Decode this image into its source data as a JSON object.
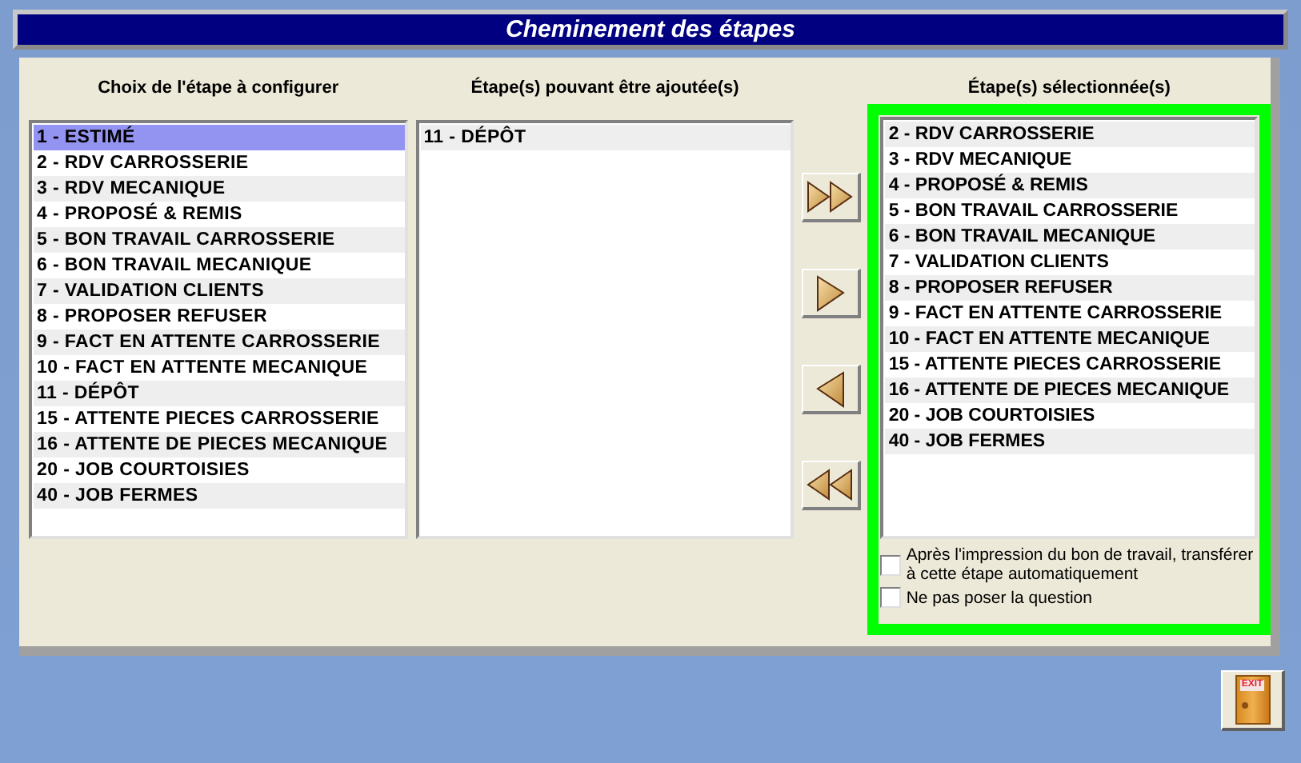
{
  "window": {
    "title": "Cheminement des étapes"
  },
  "lists": [
    {
      "heading": "Choix de l'étape à configurer",
      "items": [
        {
          "label": "1 - ESTIMÉ",
          "selected": true
        },
        {
          "label": "2 - RDV CARROSSERIE",
          "selected": false
        },
        {
          "label": "3 - RDV MECANIQUE",
          "selected": false
        },
        {
          "label": "4 - PROPOSÉ & REMIS",
          "selected": false
        },
        {
          "label": "5 - BON TRAVAIL CARROSSERIE",
          "selected": false
        },
        {
          "label": "6 - BON TRAVAIL MECANIQUE",
          "selected": false
        },
        {
          "label": "7 - VALIDATION CLIENTS",
          "selected": false
        },
        {
          "label": "8 - PROPOSER REFUSER",
          "selected": false
        },
        {
          "label": "9 - FACT EN ATTENTE CARROSSERIE",
          "selected": false
        },
        {
          "label": "10 - FACT EN ATTENTE MECANIQUE",
          "selected": false
        },
        {
          "label": "11 - DÉPÔT",
          "selected": false
        },
        {
          "label": "15 - ATTENTE PIECES CARROSSERIE",
          "selected": false
        },
        {
          "label": "16 - ATTENTE DE PIECES MECANIQUE",
          "selected": false
        },
        {
          "label": "20 - JOB COURTOISIES",
          "selected": false
        },
        {
          "label": "40 - JOB FERMES",
          "selected": false
        }
      ]
    },
    {
      "heading": "Étape(s) pouvant être ajoutée(s)",
      "items": [
        {
          "label": "11 - DÉPÔT",
          "selected": false
        }
      ]
    },
    {
      "heading": "Étape(s) sélectionnée(s)",
      "items": [
        {
          "label": "2 - RDV CARROSSERIE",
          "selected": false
        },
        {
          "label": "3 - RDV MECANIQUE",
          "selected": false
        },
        {
          "label": "4 - PROPOSÉ & REMIS",
          "selected": false
        },
        {
          "label": "5 - BON TRAVAIL CARROSSERIE",
          "selected": false
        },
        {
          "label": "6 - BON TRAVAIL MECANIQUE",
          "selected": false
        },
        {
          "label": "7 - VALIDATION CLIENTS",
          "selected": false
        },
        {
          "label": "8 - PROPOSER REFUSER",
          "selected": false
        },
        {
          "label": "9 - FACT EN ATTENTE CARROSSERIE",
          "selected": false
        },
        {
          "label": "10 - FACT EN ATTENTE MECANIQUE",
          "selected": false
        },
        {
          "label": "15 - ATTENTE PIECES CARROSSERIE",
          "selected": false
        },
        {
          "label": "16 - ATTENTE DE PIECES MECANIQUE",
          "selected": false
        },
        {
          "label": "20 - JOB COURTOISIES",
          "selected": false
        },
        {
          "label": "40 - JOB FERMES",
          "selected": false
        }
      ]
    }
  ],
  "move_buttons": [
    {
      "kind": "add-all"
    },
    {
      "kind": "add"
    },
    {
      "kind": "remove"
    },
    {
      "kind": "remove-all"
    }
  ],
  "options": [
    {
      "label": "Après l'impression du bon de travail, transférer à cette étape automatiquement",
      "checked": false
    },
    {
      "label": "Ne pas poser la question",
      "checked": false
    }
  ],
  "exit_button": {
    "label": "EXIT"
  }
}
